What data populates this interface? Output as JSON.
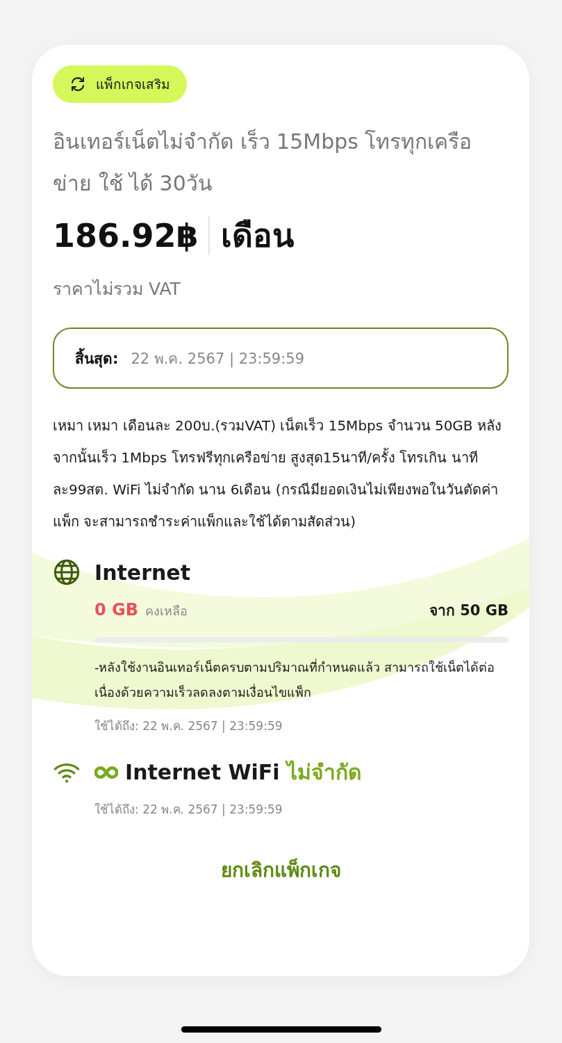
{
  "badge": {
    "label": "แพ็กเกจเสริม"
  },
  "title": "อินเทอร์เน็ตไม่จำกัด เร็ว 15Mbps โทรทุกเครือข่าย ใช้ ได้ 30วัน",
  "price": "186.92฿",
  "period": "เดือน",
  "price_note": "ราคาไม่รวม VAT",
  "expiry": {
    "label": "สิ้นสุด:",
    "value": "22 พ.ค. 2567 | 23:59:59"
  },
  "description": "เหมา เหมา เดือนละ 200บ.(รวมVAT) เน็ตเร็ว 15Mbps จำนวน 50GB หลังจากนั้นเร็ว 1Mbps โทรฟรีทุกเครือข่าย สูงสุด15นาที/ครั้ง โทรเกิน นาทีละ99สต. WiFi ไม่จำกัด นาน 6เดือน (กรณีมียอดเงินไม่เพียงพอในวันตัดค่าแพ็ก จะสามารถชำระค่าแพ็กและใช้ได้ตามสัดส่วน)",
  "quotas": [
    {
      "kind": "meter",
      "title": "Internet",
      "remaining": "0 GB",
      "remaining_label": "คงเหลือ",
      "total": "จาก 50 GB",
      "note": "-หลังใช้งานอินเทอร์เน็ตครบตามปริมาณที่กำหนดแล้ว สามารถใช้เน็ตได้ต่อเนื่องด้วยความเร็วลดลงตามเงื่อนไขแพ็ก",
      "valid": "ใช้ได้ถึง: 22 พ.ค. 2567 | 23:59:59"
    },
    {
      "kind": "unlimited",
      "title": "Internet WiFi",
      "highlight": "ไม่จำกัด",
      "valid": "ใช้ได้ถึง: 22 พ.ค. 2567 | 23:59:59"
    }
  ],
  "cancel_button": "ยกเลิกแพ็กเกจ"
}
